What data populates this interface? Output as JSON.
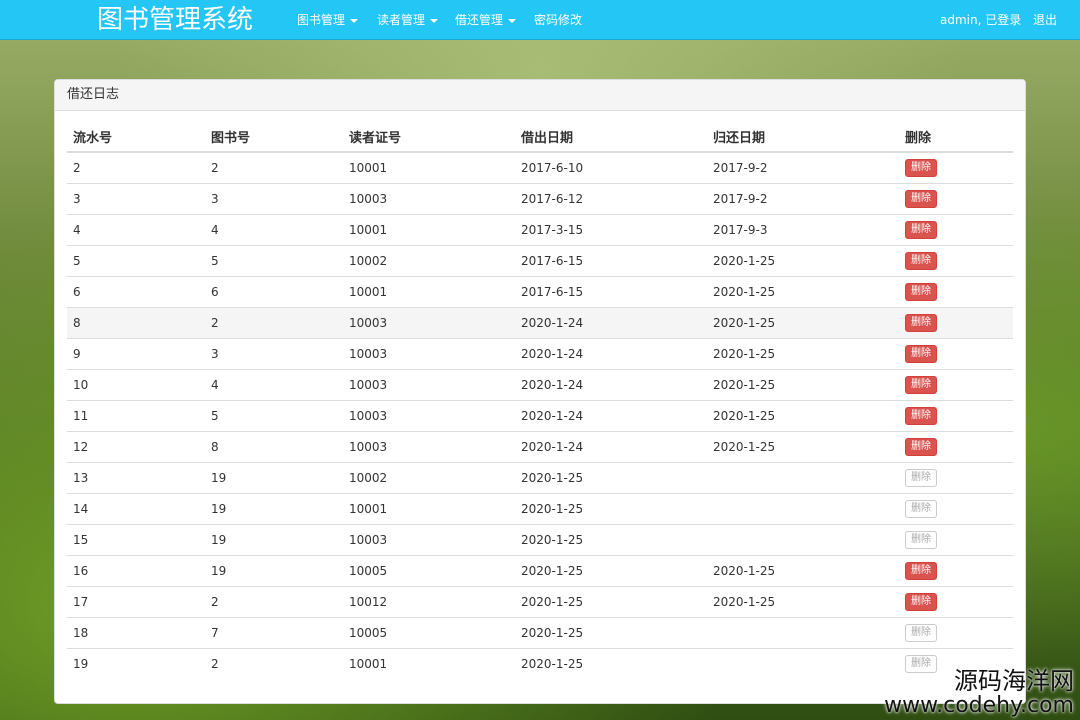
{
  "navbar": {
    "brand": "图书管理系统",
    "items": [
      {
        "label": "图书管理",
        "dropdown": true
      },
      {
        "label": "读者管理",
        "dropdown": true
      },
      {
        "label": "借还管理",
        "dropdown": true
      },
      {
        "label": "密码修改",
        "dropdown": false
      }
    ],
    "user": "admin, 已登录",
    "logout": "退出"
  },
  "panel": {
    "title": "借还日志"
  },
  "table": {
    "headers": [
      "流水号",
      "图书号",
      "读者证号",
      "借出日期",
      "归还日期",
      "删除"
    ],
    "rows": [
      {
        "id": "2",
        "book": "2",
        "reader": "10001",
        "borrow": "2017-6-10",
        "return": "2017-9-2",
        "action": "删除",
        "enabled": true
      },
      {
        "id": "3",
        "book": "3",
        "reader": "10003",
        "borrow": "2017-6-12",
        "return": "2017-9-2",
        "action": "删除",
        "enabled": true
      },
      {
        "id": "4",
        "book": "4",
        "reader": "10001",
        "borrow": "2017-3-15",
        "return": "2017-9-3",
        "action": "删除",
        "enabled": true
      },
      {
        "id": "5",
        "book": "5",
        "reader": "10002",
        "borrow": "2017-6-15",
        "return": "2020-1-25",
        "action": "删除",
        "enabled": true
      },
      {
        "id": "6",
        "book": "6",
        "reader": "10001",
        "borrow": "2017-6-15",
        "return": "2020-1-25",
        "action": "删除",
        "enabled": true
      },
      {
        "id": "8",
        "book": "2",
        "reader": "10003",
        "borrow": "2020-1-24",
        "return": "2020-1-25",
        "action": "删除",
        "enabled": true
      },
      {
        "id": "9",
        "book": "3",
        "reader": "10003",
        "borrow": "2020-1-24",
        "return": "2020-1-25",
        "action": "删除",
        "enabled": true
      },
      {
        "id": "10",
        "book": "4",
        "reader": "10003",
        "borrow": "2020-1-24",
        "return": "2020-1-25",
        "action": "删除",
        "enabled": true
      },
      {
        "id": "11",
        "book": "5",
        "reader": "10003",
        "borrow": "2020-1-24",
        "return": "2020-1-25",
        "action": "删除",
        "enabled": true
      },
      {
        "id": "12",
        "book": "8",
        "reader": "10003",
        "borrow": "2020-1-24",
        "return": "2020-1-25",
        "action": "删除",
        "enabled": true
      },
      {
        "id": "13",
        "book": "19",
        "reader": "10002",
        "borrow": "2020-1-25",
        "return": "",
        "action": "删除",
        "enabled": false
      },
      {
        "id": "14",
        "book": "19",
        "reader": "10001",
        "borrow": "2020-1-25",
        "return": "",
        "action": "删除",
        "enabled": false
      },
      {
        "id": "15",
        "book": "19",
        "reader": "10003",
        "borrow": "2020-1-25",
        "return": "",
        "action": "删除",
        "enabled": false
      },
      {
        "id": "16",
        "book": "19",
        "reader": "10005",
        "borrow": "2020-1-25",
        "return": "2020-1-25",
        "action": "删除",
        "enabled": true
      },
      {
        "id": "17",
        "book": "2",
        "reader": "10012",
        "borrow": "2020-1-25",
        "return": "2020-1-25",
        "action": "删除",
        "enabled": true
      },
      {
        "id": "18",
        "book": "7",
        "reader": "10005",
        "borrow": "2020-1-25",
        "return": "",
        "action": "删除",
        "enabled": false
      },
      {
        "id": "19",
        "book": "2",
        "reader": "10001",
        "borrow": "2020-1-25",
        "return": "",
        "action": "删除",
        "enabled": false
      }
    ]
  },
  "watermark": {
    "line1": "源码海洋网",
    "line2": "www.codehy.com"
  },
  "colors": {
    "navbar": "#23c6f5",
    "danger": "#d9534f",
    "highlight_row": "#f5f5f5"
  }
}
